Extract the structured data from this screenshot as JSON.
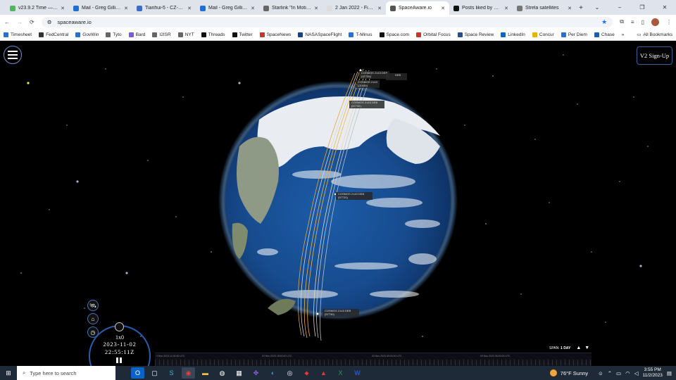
{
  "browser": {
    "tabs": [
      {
        "label": "v23.9.2 Time — Tim",
        "color": "#55b45e",
        "active": false
      },
      {
        "label": "Mail - Greg Gillinge",
        "color": "#1f6fd0",
        "active": false
      },
      {
        "label": "Tianhui-5 - CZ-6A - ",
        "color": "#3b6ec8",
        "active": false
      },
      {
        "label": "Mail - Greg Gillinge",
        "color": "#1f6fd0",
        "active": false
      },
      {
        "label": "Starlink \"In Motion\"",
        "color": "#666",
        "active": false
      },
      {
        "label": "2 Jan 2022 - Final F",
        "color": "#ddd",
        "active": false
      },
      {
        "label": "SpaceAware.io",
        "color": "#555",
        "active": true
      },
      {
        "label": "Posts liked by Greg",
        "color": "#111",
        "active": false
      },
      {
        "label": "Strela satellites",
        "color": "#777",
        "active": false
      }
    ],
    "new_tab": "+",
    "window_controls": [
      "⌄",
      "−",
      "❐",
      "✕"
    ],
    "url": "spaceaware.io",
    "bookmarks": [
      {
        "label": "Timesheet",
        "color": "#2a6fd6"
      },
      {
        "label": "FedCentral",
        "color": "#333"
      },
      {
        "label": "GovWin",
        "color": "#2a6fd6"
      },
      {
        "label": "Tyto",
        "color": "#666"
      },
      {
        "label": "Bard",
        "color": "#7a5ad6"
      },
      {
        "label": "I2ISR",
        "color": "#666"
      },
      {
        "label": "NYT",
        "color": "#666"
      },
      {
        "label": "Threads",
        "color": "#111"
      },
      {
        "label": "Twitter",
        "color": "#111"
      },
      {
        "label": "SpaceNews",
        "color": "#c0392b"
      },
      {
        "label": "NASASpaceFlight",
        "color": "#1a3f8b"
      },
      {
        "label": "T-Minus",
        "color": "#2a6fd6"
      },
      {
        "label": "Space.com",
        "color": "#111"
      },
      {
        "label": "Orbital Focus",
        "color": "#c0392b"
      },
      {
        "label": "Space Review",
        "color": "#2a4f8b"
      },
      {
        "label": "LinkedIn",
        "color": "#0a66c2"
      },
      {
        "label": "Concur",
        "color": "#e8b400"
      },
      {
        "label": "Per Diem",
        "color": "#2a6fd6"
      },
      {
        "label": "Chase",
        "color": "#1a5fb4"
      }
    ],
    "all_bookmarks": "All Bookmarks"
  },
  "app": {
    "signup_label": "V2 Sign-Up",
    "satellite_labels": [
      {
        "name": "COSMOS 2143 DEB",
        "id": "(57735)"
      },
      {
        "name": "COSMOS 2143",
        "id": "(21939)"
      },
      {
        "name": "COSMOS 2143 DEB",
        "id": "(57732)"
      },
      {
        "name": "COSMOS 2143 DEB",
        "id": "(57720)"
      },
      {
        "name": "COSMOS 2143 DEB",
        "id": "(57730)"
      }
    ],
    "partial_label": "DEB",
    "clock": {
      "speed": "1x0",
      "date": "2023-11-02",
      "time": "22:55:11Z"
    },
    "timeline_ticks": [
      "2 Nov 2023 12:00:00 UTC",
      "02 Nov 2023 18:00:00 UTC",
      "03 Nov 2023 00:00:00 UTC",
      "03 Nov 2023 06:00:00 UTC"
    ],
    "span_prefix": "SPAN:",
    "span_value": "1 DAY"
  },
  "taskbar": {
    "search_placeholder": "Type here to search",
    "weather": "76°F  Sunny",
    "time": "3:55 PM",
    "date": "11/2/2023"
  }
}
